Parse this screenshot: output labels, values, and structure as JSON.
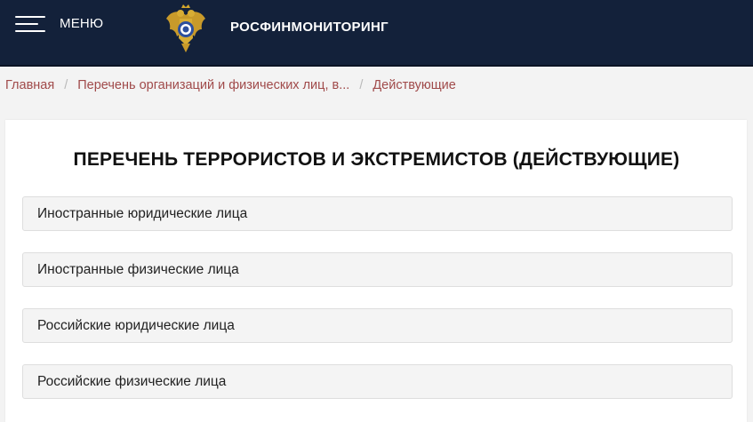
{
  "header": {
    "menu_label": "МЕНЮ",
    "brand": "РОСФИНМОНИТОРИНГ",
    "icons": [
      "hamburger-icon",
      "emblem-logo"
    ],
    "colors": {
      "header_bg": "#13213a",
      "link": "#a04a4a",
      "accordion_bg": "#f4f4f4"
    }
  },
  "breadcrumb": [
    {
      "label": "Главная"
    },
    {
      "label": "Перечень организаций и физических лиц, в..."
    },
    {
      "label": "Действующие"
    }
  ],
  "main": {
    "title": "ПЕРЕЧЕНЬ ТЕРРОРИСТОВ И ЭКСТРЕМИСТОВ (ДЕЙСТВУЮЩИЕ)",
    "sections": [
      {
        "label": "Иностранные юридические лица"
      },
      {
        "label": "Иностранные физические лица"
      },
      {
        "label": "Российские юридические лица"
      },
      {
        "label": "Российские физические лица"
      }
    ]
  }
}
